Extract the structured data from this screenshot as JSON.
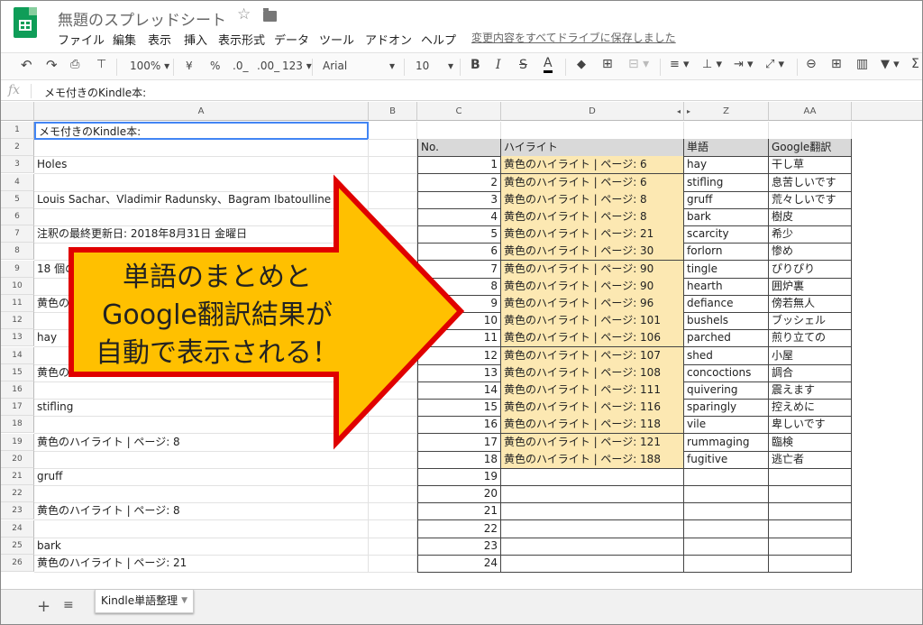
{
  "doc": {
    "title": "無題のスプレッドシート",
    "save_status": "変更内容をすべてドライブに保存しました"
  },
  "menu": [
    "ファイル",
    "編集",
    "表示",
    "挿入",
    "表示形式",
    "データ",
    "ツール",
    "アドオン",
    "ヘルプ"
  ],
  "toolbar": {
    "zoom": "100%",
    "currency": "¥",
    "percent": "%",
    "dec_less": ".0_",
    "dec_more": ".00_",
    "format_more": "123",
    "font": "Arial",
    "font_size": "10"
  },
  "formula_bar": {
    "icon": "fx",
    "value": "メモ付きのKindle本:"
  },
  "columns": {
    "A": "A",
    "B": "B",
    "C": "C",
    "D": "D",
    "Z": "Z",
    "AA": "AA"
  },
  "rows": [
    "1",
    "2",
    "3",
    "4",
    "5",
    "6",
    "7",
    "8",
    "9",
    "10",
    "11",
    "12",
    "13",
    "14",
    "15",
    "16",
    "17",
    "18",
    "19",
    "20",
    "21",
    "22",
    "23",
    "24",
    "25",
    "26"
  ],
  "colA": {
    "r1": "メモ付きのKindle本:",
    "r3": "Holes",
    "r5": "Louis Sachar、Vladimir Radunsky、Bagram Ibatoulline",
    "r7": "注釈の最終更新日: 2018年8月31日 金曜日",
    "r9": "18 個の",
    "r11": "黄色の",
    "r13": "hay",
    "r15": "黄色の",
    "r17": "stifling",
    "r19": "黄色のハイライト | ページ: 8",
    "r21": "gruff",
    "r23": "黄色のハイライト | ページ: 8",
    "r25": "bark",
    "r26": "黄色のハイライト | ページ: 21"
  },
  "table": {
    "headers": [
      "No.",
      "ハイライト",
      "単語",
      "Google翻訳"
    ],
    "rows": [
      [
        "1",
        "黄色のハイライト | ページ: 6",
        "hay",
        "干し草"
      ],
      [
        "2",
        "黄色のハイライト | ページ: 6",
        "stifling",
        "息苦しいです"
      ],
      [
        "3",
        "黄色のハイライト | ページ: 8",
        "gruff",
        "荒々しいです"
      ],
      [
        "4",
        "黄色のハイライト | ページ: 8",
        "bark",
        "樹皮"
      ],
      [
        "5",
        "黄色のハイライト | ページ: 21",
        "scarcity",
        "希少"
      ],
      [
        "6",
        "黄色のハイライト | ページ: 30",
        "forlorn",
        "惨め"
      ],
      [
        "7",
        "黄色のハイライト | ページ: 90",
        "tingle",
        "ぴりぴり"
      ],
      [
        "8",
        "黄色のハイライト | ページ: 90",
        "hearth",
        "囲炉裏"
      ],
      [
        "9",
        "黄色のハイライト | ページ: 96",
        "defiance",
        "傍若無人"
      ],
      [
        "10",
        "黄色のハイライト | ページ: 101",
        "bushels",
        "ブッシェル"
      ],
      [
        "11",
        "黄色のハイライト | ページ: 106",
        "parched",
        "煎り立ての"
      ],
      [
        "12",
        "黄色のハイライト | ページ: 107",
        "shed",
        "小屋"
      ],
      [
        "13",
        "黄色のハイライト | ページ: 108",
        "concoctions",
        "調合"
      ],
      [
        "14",
        "黄色のハイライト | ページ: 111",
        "quivering",
        "震えます"
      ],
      [
        "15",
        "黄色のハイライト | ページ: 116",
        "sparingly",
        "控えめに"
      ],
      [
        "16",
        "黄色のハイライト | ページ: 118",
        "vile",
        "卑しいです"
      ],
      [
        "17",
        "黄色のハイライト | ページ: 121",
        "rummaging",
        "臨検"
      ],
      [
        "18",
        "黄色のハイライト | ページ: 188",
        "fugitive",
        "逃亡者"
      ]
    ],
    "empty_nos": [
      "19",
      "20",
      "21",
      "22",
      "23",
      "24",
      "25"
    ]
  },
  "callout": {
    "line1": "単語のまとめと",
    "line2": "Google翻訳結果が",
    "line3": "自動で表示される！"
  },
  "sheet": {
    "tab_label": "Kindle単語整理",
    "add": "+",
    "all": "≡"
  },
  "colors": {
    "arrow_fill": "#ffc000",
    "arrow_stroke": "#e00000",
    "highlight": "#fce8b2",
    "logo": "#0f9d58"
  },
  "icons": [
    "undo-icon",
    "redo-icon",
    "print-icon",
    "paint-format-icon",
    "bold-icon",
    "italic-icon",
    "strikethrough-icon",
    "text-color-icon",
    "fill-color-icon",
    "borders-icon",
    "merge-icon",
    "align-icon",
    "valign-icon",
    "wrap-icon",
    "rotate-icon",
    "link-icon",
    "comment-icon",
    "chart-icon",
    "filter-icon",
    "functions-icon"
  ]
}
